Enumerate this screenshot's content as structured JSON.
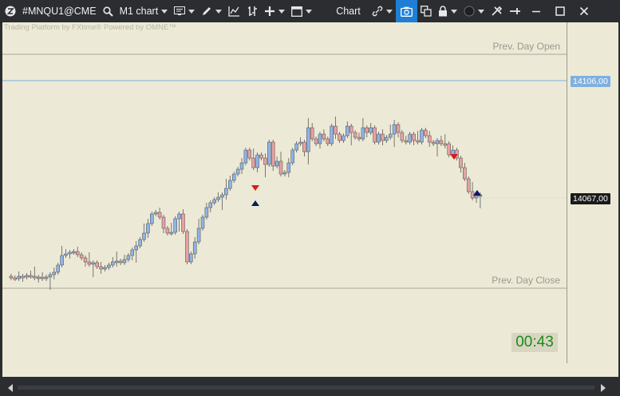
{
  "toolbar": {
    "symbol": "#MNQU1@CME",
    "timeframe": "M1 chart",
    "chart_label": "Chart"
  },
  "chart": {
    "watermark": "Trading Platform by FXtime®  Powered by OMNE™",
    "prev_day_open_label": "Prev. Day Open",
    "prev_day_close_label": "Prev. Day Close",
    "level_price": "14106,00",
    "current_price": "14067,00",
    "timer": "00:43",
    "colors": {
      "bull": "#8fb3e8",
      "bear": "#e8a0a4",
      "level_line": "#7fb0e0",
      "background": "#ecead6",
      "timer_text": "#1d8a1d"
    }
  },
  "chart_data": {
    "type": "candlestick",
    "price_labels": [
      "14106,00",
      "14067,00"
    ],
    "reference_lines": [
      "Prev. Day Open",
      "Prev. Day Close"
    ]
  }
}
